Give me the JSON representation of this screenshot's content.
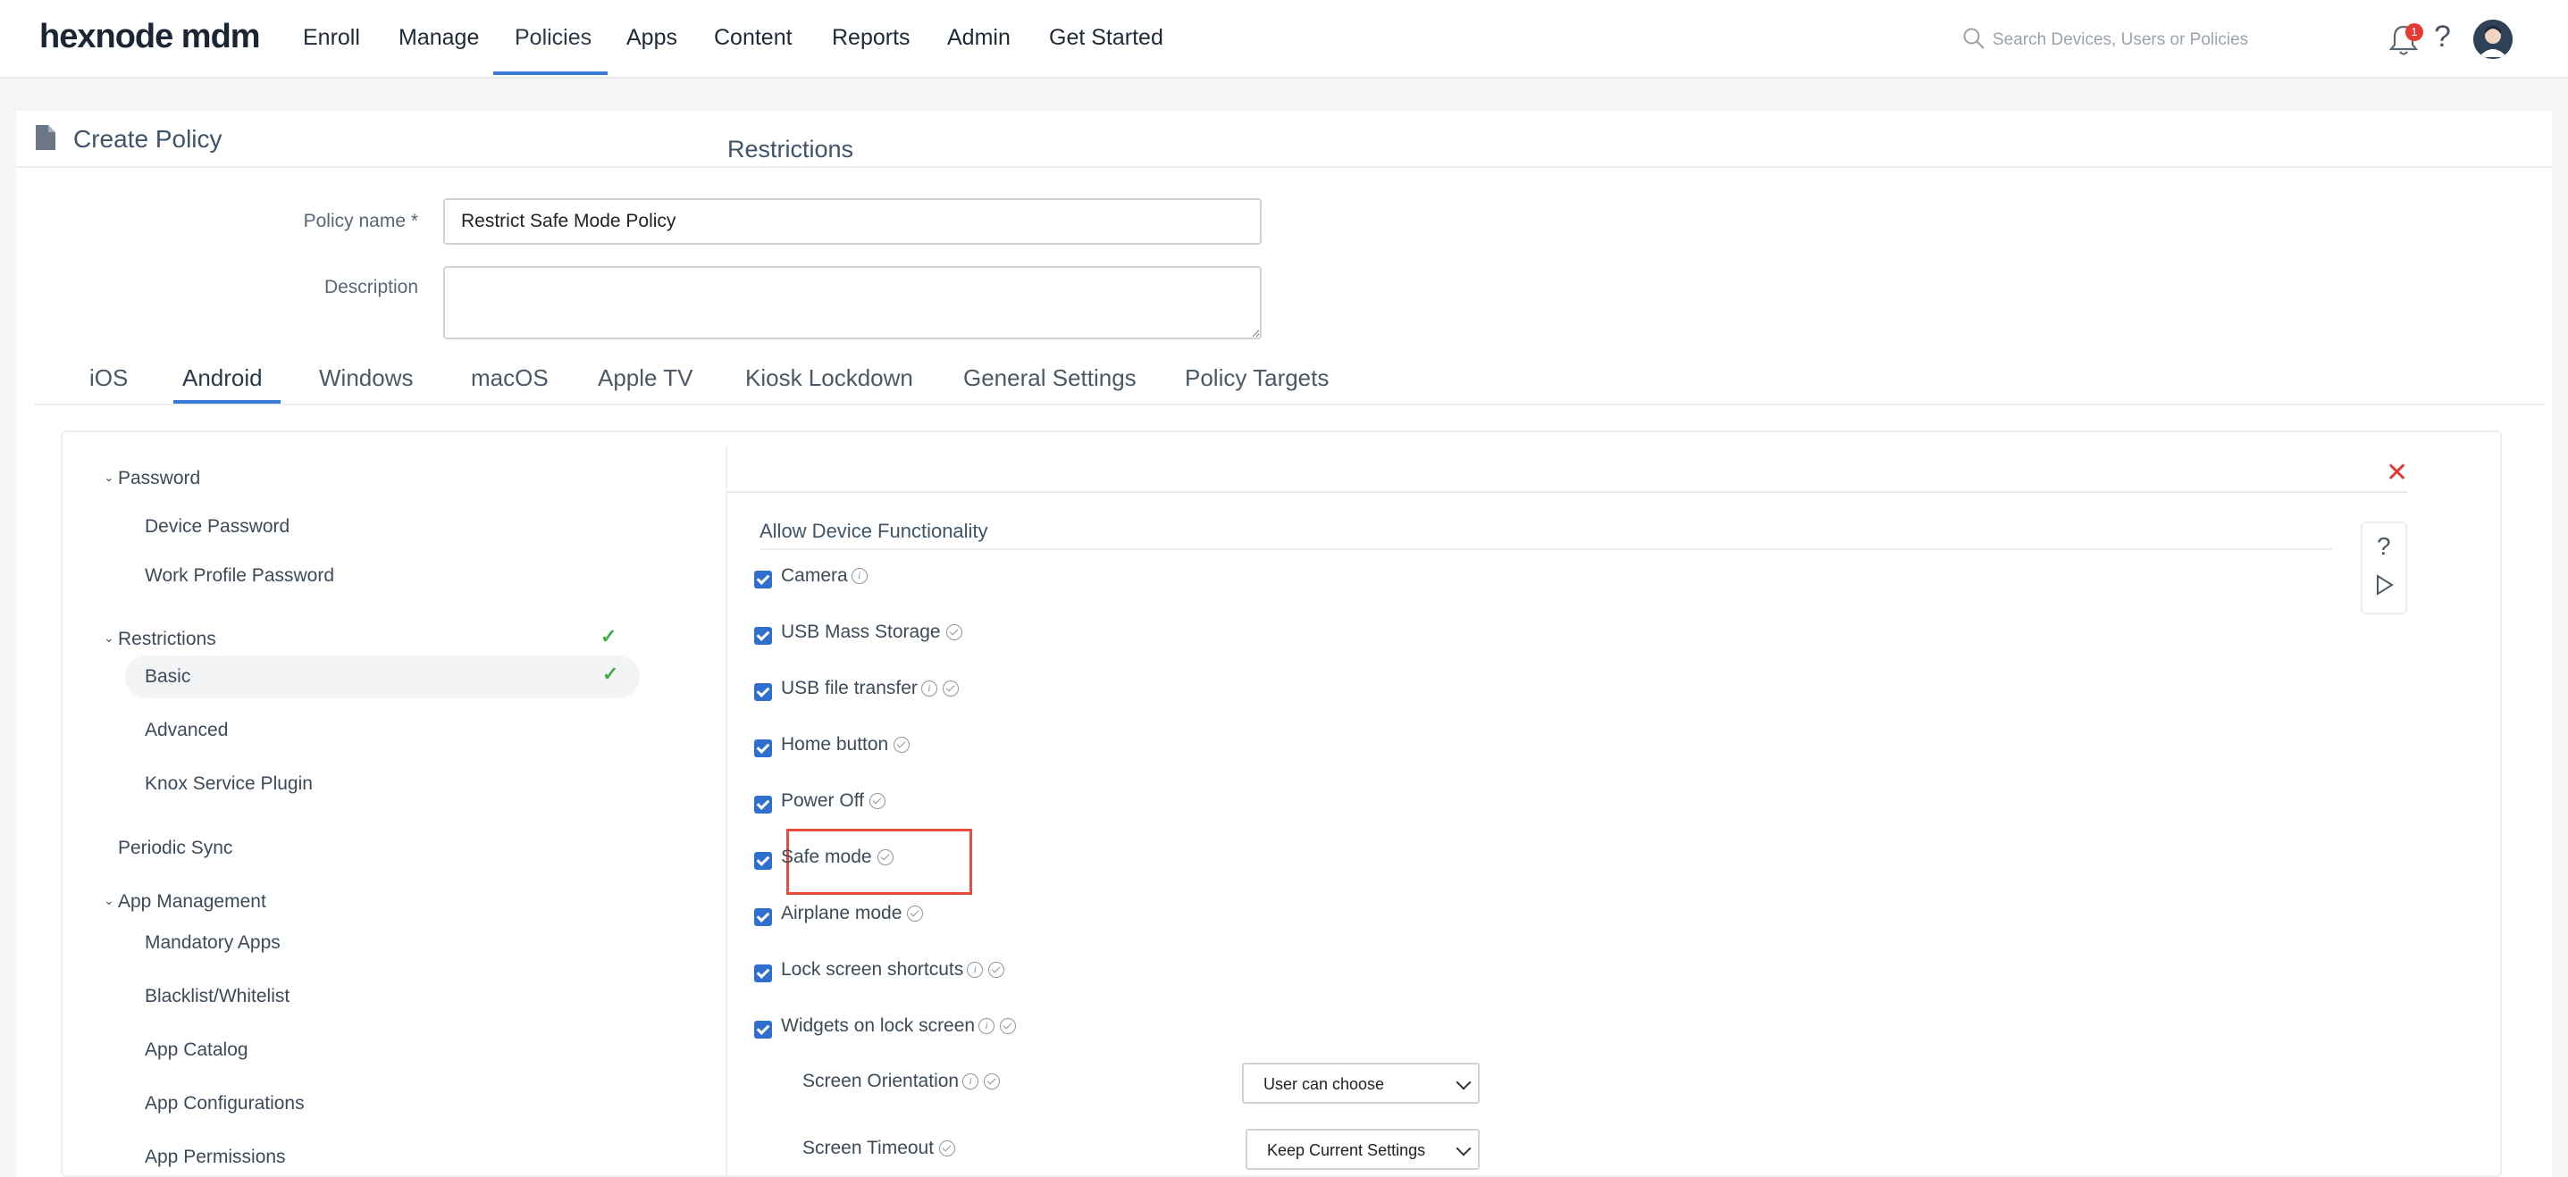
{
  "brand": "hexnode mdm",
  "nav": {
    "items": [
      "Enroll",
      "Manage",
      "Policies",
      "Apps",
      "Content",
      "Reports",
      "Admin",
      "Get Started"
    ],
    "active": "Policies"
  },
  "search": {
    "placeholder": "Search Devices, Users or Policies"
  },
  "notifications": {
    "count": "1"
  },
  "help_glyph": "?",
  "page": {
    "title": "Create Policy",
    "policy_name_label": "Policy name *",
    "policy_name_value": "Restrict Safe Mode Policy",
    "description_label": "Description",
    "description_value": ""
  },
  "os_tabs": [
    "iOS",
    "Android",
    "Windows",
    "macOS",
    "Apple TV",
    "Kiosk Lockdown",
    "General Settings",
    "Policy Targets"
  ],
  "active_os_tab": "Android",
  "sidebar": {
    "password_group": "Password",
    "password_items": [
      "Device Password",
      "Work Profile Password"
    ],
    "restrictions_group": "Restrictions",
    "restrictions_items": [
      "Basic",
      "Advanced",
      "Knox Service Plugin"
    ],
    "selected_item": "Basic",
    "periodic_sync": "Periodic Sync",
    "app_management_group": "App Management",
    "app_management_items": [
      "Mandatory Apps",
      "Blacklist/Whitelist",
      "App Catalog",
      "App Configurations",
      "App Permissions"
    ]
  },
  "restrictions": {
    "title": "Restrictions",
    "group_title": "Allow Device Functionality",
    "checkboxes": [
      {
        "label": "Camera",
        "checked": true,
        "info": true,
        "verified": false
      },
      {
        "label": "USB Mass Storage",
        "checked": true,
        "info": false,
        "verified": true
      },
      {
        "label": "USB file transfer",
        "checked": true,
        "info": true,
        "verified": true
      },
      {
        "label": "Home button",
        "checked": true,
        "info": false,
        "verified": true
      },
      {
        "label": "Power Off",
        "checked": true,
        "info": false,
        "verified": true
      },
      {
        "label": "Safe mode",
        "checked": true,
        "info": false,
        "verified": true
      },
      {
        "label": "Airplane mode",
        "checked": true,
        "info": false,
        "verified": true
      },
      {
        "label": "Lock screen shortcuts",
        "checked": true,
        "info": true,
        "verified": true
      },
      {
        "label": "Widgets on lock screen",
        "checked": true,
        "info": true,
        "verified": true
      }
    ],
    "screen_orientation_label": "Screen Orientation",
    "screen_orientation_value": "User can choose",
    "screen_timeout_label": "Screen Timeout",
    "screen_timeout_value": "Keep Current Settings"
  },
  "colors": {
    "accent": "#3a7bd5",
    "checkbox": "#2f6fd0",
    "highlight": "#e74c3c",
    "success": "#3fae49"
  }
}
